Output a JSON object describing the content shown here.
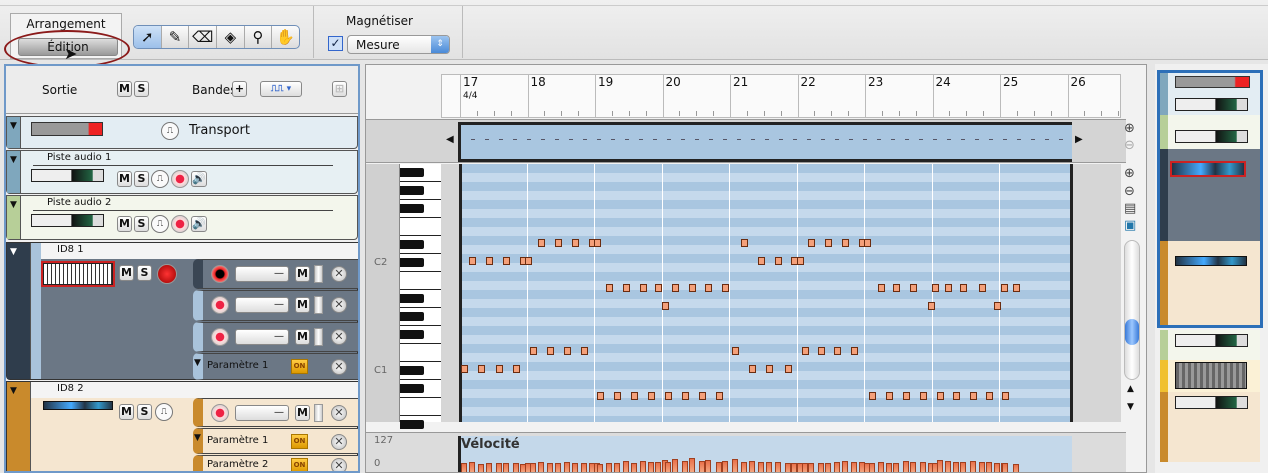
{
  "toolbar": {
    "mode_arrangement": "Arrangement",
    "mode_edition": "Édition",
    "tools": [
      "arrow-icon",
      "pencil-icon",
      "eraser-icon",
      "mute-tool-icon",
      "magnifier-icon",
      "hand-icon"
    ],
    "snap_label": "Magnétiser",
    "snap_checked": true,
    "snap_value": "Mesure"
  },
  "left_panel": {
    "header": {
      "output_label": "Sortie",
      "mute": "M",
      "solo": "S",
      "lanes_label": "Bandes",
      "add": "+"
    },
    "transport": {
      "label": "Transport"
    },
    "tracks": [
      {
        "name": "Piste audio 1",
        "mute": "M",
        "solo": "S"
      },
      {
        "name": "Piste audio 2",
        "mute": "M",
        "solo": "S"
      },
      {
        "name": "ID8 1",
        "mute": "M",
        "solo": "S",
        "param": "Paramètre 1",
        "on": "ON",
        "dropdown": "—",
        "sub_mute": "M"
      },
      {
        "name": "ID8 2",
        "mute": "M",
        "solo": "S",
        "params": [
          "Paramètre 1",
          "Paramètre 2"
        ],
        "on": "ON",
        "dropdown": "—",
        "sub_mute": "M"
      }
    ]
  },
  "editor": {
    "bars": [
      "17",
      "18",
      "19",
      "20",
      "21",
      "22",
      "23",
      "24",
      "25",
      "26"
    ],
    "time_signature": "4/4",
    "key_labels": {
      "c2": "C2",
      "c1": "C1"
    },
    "velocity": {
      "label": "Vélocité",
      "max": "127",
      "min": "0"
    }
  },
  "notes_legend": "beat offset from bar 17, semitones above C1, velocity",
  "notes": [
    [
      0.1,
      0,
      50
    ],
    [
      1.1,
      0,
      48
    ],
    [
      2.2,
      0,
      52
    ],
    [
      3.2,
      0,
      50
    ],
    [
      0.6,
      12,
      55
    ],
    [
      1.6,
      12,
      50
    ],
    [
      2.6,
      12,
      52
    ],
    [
      3.6,
      12,
      48
    ],
    [
      3.9,
      12,
      50
    ],
    [
      4.2,
      2,
      52
    ],
    [
      5.2,
      2,
      50
    ],
    [
      6.2,
      2,
      54
    ],
    [
      7.2,
      2,
      50
    ],
    [
      4.7,
      14,
      55
    ],
    [
      5.7,
      14,
      50
    ],
    [
      6.7,
      14,
      52
    ],
    [
      7.7,
      14,
      50
    ],
    [
      8.0,
      14,
      52
    ],
    [
      8.2,
      -3,
      48
    ],
    [
      9.2,
      -3,
      50
    ],
    [
      10.2,
      -3,
      52
    ],
    [
      11.2,
      -3,
      54
    ],
    [
      12.2,
      -3,
      56
    ],
    [
      13.2,
      -3,
      60
    ],
    [
      14.2,
      -3,
      58
    ],
    [
      15.2,
      -3,
      56
    ],
    [
      8.7,
      9,
      50
    ],
    [
      9.7,
      9,
      58
    ],
    [
      10.7,
      9,
      60
    ],
    [
      11.6,
      9,
      56
    ],
    [
      12.6,
      9,
      66
    ],
    [
      13.6,
      9,
      70
    ],
    [
      14.6,
      9,
      64
    ],
    [
      15.6,
      9,
      60
    ],
    [
      12.0,
      7,
      62
    ],
    [
      16.2,
      2,
      68
    ],
    [
      16.7,
      14,
      56
    ],
    [
      17.2,
      0,
      58
    ],
    [
      18.2,
      0,
      56
    ],
    [
      19.3,
      0,
      52
    ],
    [
      17.7,
      12,
      54
    ],
    [
      18.7,
      12,
      56
    ],
    [
      19.7,
      12,
      52
    ],
    [
      20.0,
      12,
      50
    ],
    [
      20.3,
      2,
      52
    ],
    [
      21.3,
      2,
      50
    ],
    [
      22.2,
      2,
      54
    ],
    [
      23.2,
      2,
      56
    ],
    [
      20.7,
      14,
      52
    ],
    [
      21.7,
      14,
      50
    ],
    [
      22.7,
      14,
      58
    ],
    [
      23.7,
      14,
      54
    ],
    [
      24.0,
      14,
      52
    ],
    [
      24.3,
      -3,
      50
    ],
    [
      25.3,
      -3,
      52
    ],
    [
      26.3,
      -3,
      60
    ],
    [
      27.3,
      -3,
      54
    ],
    [
      28.3,
      -3,
      62
    ],
    [
      29.3,
      -3,
      56
    ],
    [
      30.3,
      -3,
      58
    ],
    [
      31.2,
      -3,
      54
    ],
    [
      32.2,
      -3,
      52
    ],
    [
      24.8,
      9,
      56
    ],
    [
      25.7,
      9,
      52
    ],
    [
      26.7,
      9,
      54
    ],
    [
      28.0,
      9,
      50
    ],
    [
      28.8,
      9,
      60
    ],
    [
      29.7,
      9,
      54
    ],
    [
      30.8,
      9,
      56
    ],
    [
      32.1,
      9,
      50
    ],
    [
      32.8,
      9,
      48
    ],
    [
      27.8,
      7,
      52
    ],
    [
      31.7,
      7,
      50
    ]
  ],
  "colors": {
    "accent_blue": "#5b8cc4",
    "audio1_strip": "#7fa7bd",
    "audio2_strip": "#b7cf98",
    "id8_1_strip": "#2f3d4c",
    "id8_2_strip": "#c98a2c",
    "note_fill": "#f4a07a",
    "annotation_ellipse": "#8b1a1a"
  }
}
